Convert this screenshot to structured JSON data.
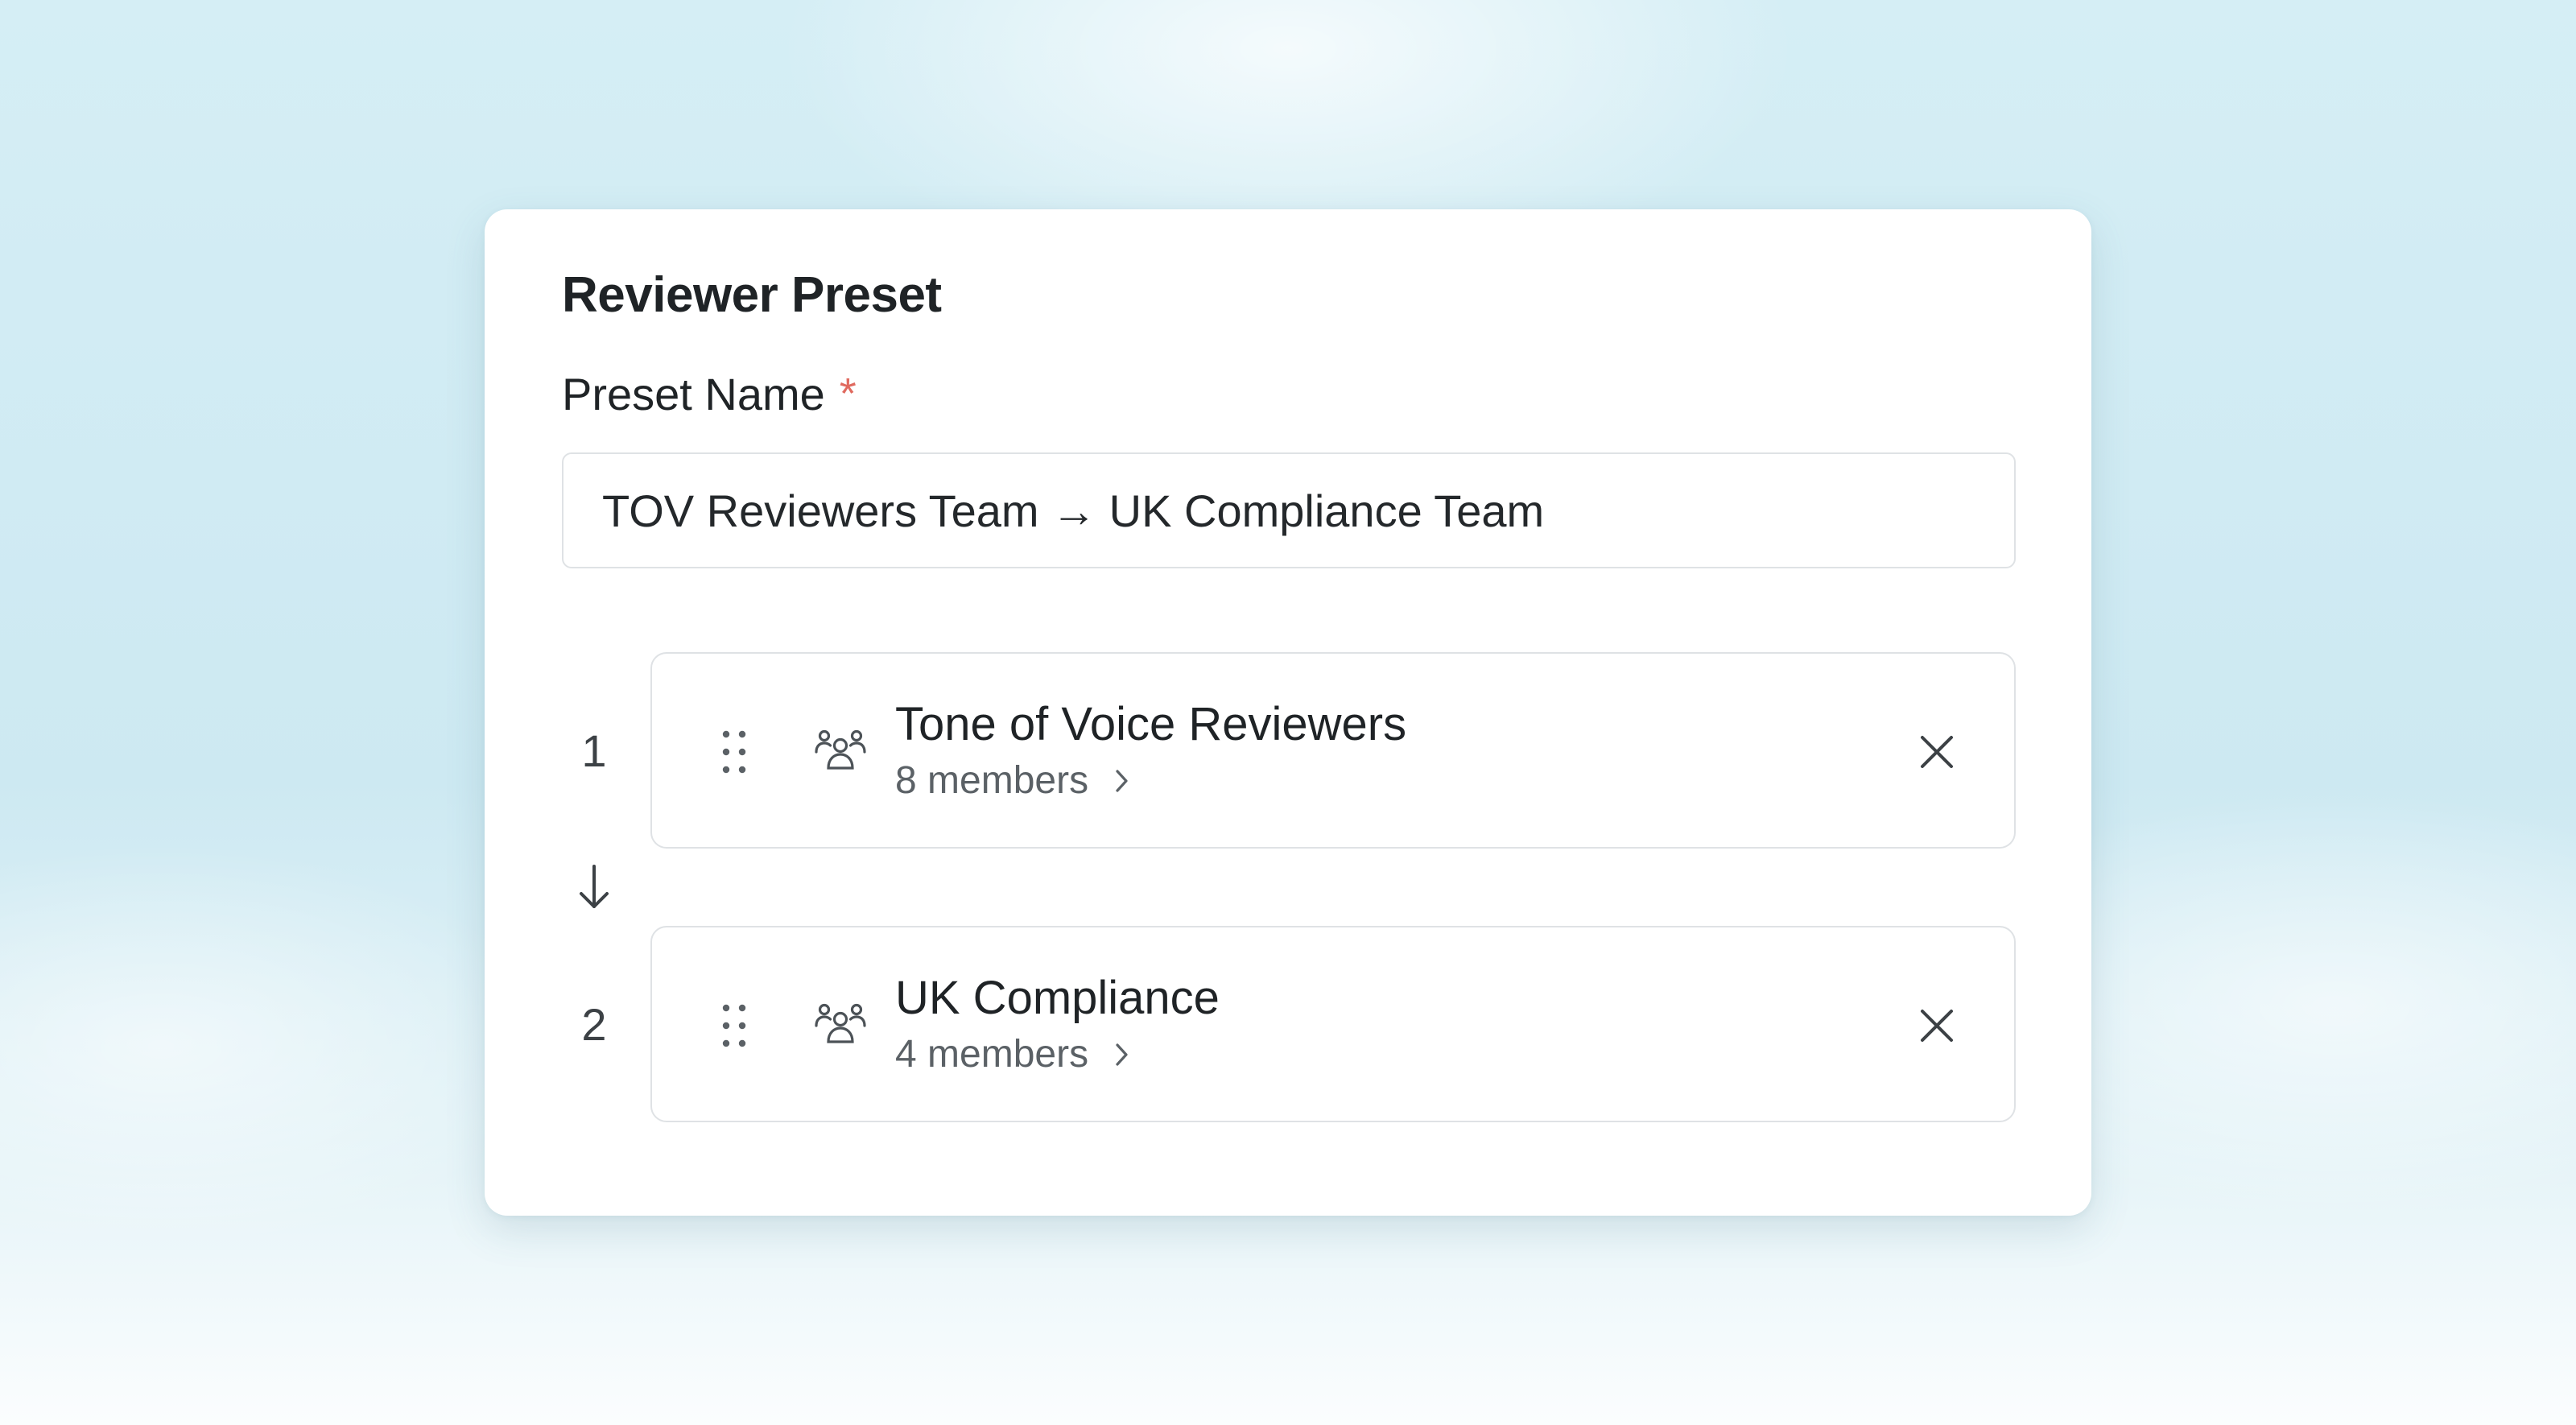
{
  "card": {
    "title": "Reviewer Preset",
    "preset_name_label": "Preset Name",
    "required_marker": "*",
    "preset_name_value": "TOV Reviewers Team → UK Compliance Team"
  },
  "steps": [
    {
      "number": "1",
      "title": "Tone of Voice Reviewers",
      "members": "8 members"
    },
    {
      "number": "2",
      "title": "UK Compliance",
      "members": "4 members"
    }
  ],
  "icons": {
    "drag": "drag-handle-icon",
    "group": "group-icon",
    "chevron": "chevron-right-icon",
    "close": "close-icon",
    "flow": "arrow-down-icon"
  },
  "colors": {
    "required": "#e06a5f",
    "text_primary": "#1f2326",
    "text_secondary": "#5b6166",
    "border": "#dfe2e5"
  }
}
